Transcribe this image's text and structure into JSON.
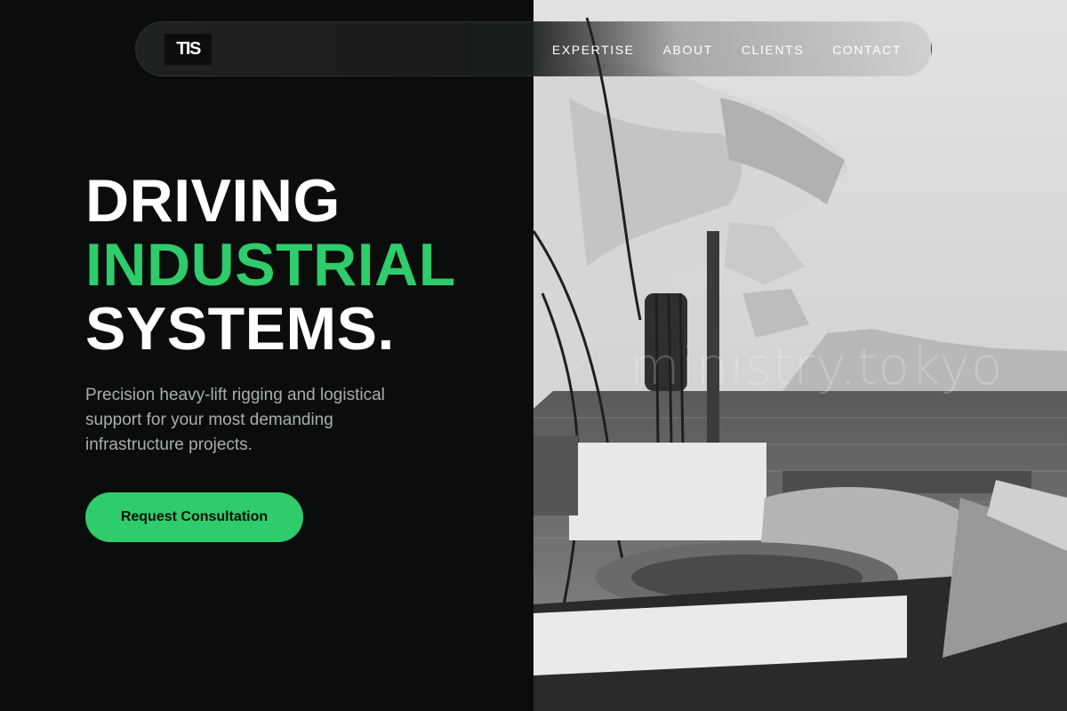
{
  "brand": {
    "logo_text": "TIS"
  },
  "nav": {
    "links": [
      {
        "label": "EXPERTISE"
      },
      {
        "label": "ABOUT"
      },
      {
        "label": "CLIENTS"
      },
      {
        "label": "CONTACT"
      }
    ]
  },
  "hero": {
    "headline_line1": "DRIVING",
    "headline_line2": "INDUSTRIAL",
    "headline_line3": "SYSTEMS.",
    "subtitle": "Precision heavy-lift rigging and logistical support for your most demanding infrastructure projects.",
    "cta_label": "Request Consultation",
    "image_watermark": "ministry.tokyo"
  },
  "colors": {
    "background": "#0b0d0d",
    "accent": "#2ecc6a",
    "text": "#ffffff",
    "muted_text": "#a9adac"
  }
}
